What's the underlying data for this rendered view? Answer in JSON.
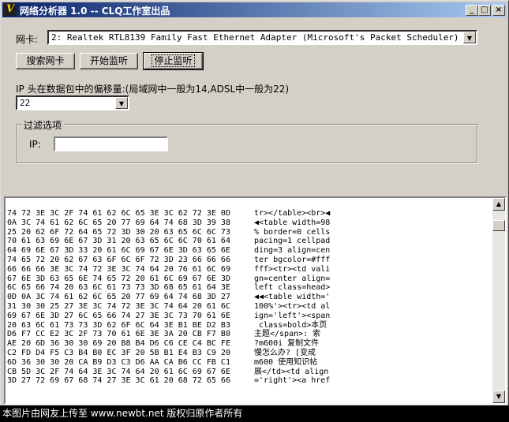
{
  "window": {
    "title": "网络分析器 1.0 -- CLQ工作室出品",
    "icon_glyph": "V",
    "minimize_glyph": "_",
    "maximize_glyph": "□",
    "close_glyph": "×"
  },
  "adapter": {
    "label": "网卡:",
    "value": "2: Realtek RTL8139 Family Fast Ethernet Adapter (Microsoft's Packet Scheduler)"
  },
  "buttons": {
    "search": "搜索网卡",
    "start": "开始监听",
    "stop": "停止监听"
  },
  "offset": {
    "label": "IP 头在数据包中的偏移量:(局域网中一般为14,ADSL中一般为22)",
    "value": "22"
  },
  "filter": {
    "group_title": "过滤选项",
    "ip_label": "IP:",
    "ip_value": ""
  },
  "dump": {
    "rows": [
      {
        "hex": "74 72 3E 3C 2F 74 61 62 6C 65 3E 3C 62 72 3E 0D",
        "ascii": "tr></table><br>◀"
      },
      {
        "hex": "0A 3C 74 61 62 6C 65 20 77 69 64 74 68 3D 39 38",
        "ascii": "◀<table width=98"
      },
      {
        "hex": "25 20 62 6F 72 64 65 72 3D 30 20 63 65 6C 6C 73",
        "ascii": "% border=0 cells"
      },
      {
        "hex": "70 61 63 69 6E 67 3D 31 20 63 65 6C 6C 70 61 64",
        "ascii": "pacing=1 cellpad"
      },
      {
        "hex": "64 69 6E 67 3D 33 20 61 6C 69 67 6E 3D 63 65 6E",
        "ascii": "ding=3 align=cen"
      },
      {
        "hex": "74 65 72 20 62 67 63 6F 6C 6F 72 3D 23 66 66 66",
        "ascii": "ter bgcolor=#fff"
      },
      {
        "hex": "66 66 66 3E 3C 74 72 3E 3C 74 64 20 76 61 6C 69",
        "ascii": "fff><tr><td vali"
      },
      {
        "hex": "67 6E 3D 63 65 6E 74 65 72 20 61 6C 69 67 6E 3D",
        "ascii": "gn=center align="
      },
      {
        "hex": "6C 65 66 74 20 63 6C 61 73 73 3D 68 65 61 64 3E",
        "ascii": "left class=head>"
      },
      {
        "hex": "0D 0A 3C 74 61 62 6C 65 20 77 69 64 74 68 3D 27",
        "ascii": "◀◀<table width='"
      },
      {
        "hex": "31 30 30 25 27 3E 3C 74 72 3E 3C 74 64 20 61 6C",
        "ascii": "100%'><tr><td al"
      },
      {
        "hex": "69 67 6E 3D 27 6C 65 66 74 27 3E 3C 73 70 61 6E",
        "ascii": "ign='left'><span"
      },
      {
        "hex": "20 63 6C 61 73 73 3D 62 6F 6C 64 3E B1 BE D2 B3",
        "ascii": " class=bold>本页"
      },
      {
        "hex": "D6 F7 CC E2 3C 2F 73 70 61 6E 3E 3A 20 CB F7 B0",
        "ascii": "主题</span>: 索"
      },
      {
        "hex": "AE 20 6D 36 30 30 69 20 B8 B4 D6 C6 CE C4 BC FE",
        "ascii": "?m600i 复制文件"
      },
      {
        "hex": "C2 FD D4 F5 C3 B4 B0 EC 3F 20 5B B1 E4 B3 C9 20",
        "ascii": "慢怎么办? [变成"
      },
      {
        "hex": "6D 36 30 30 20 CA B9 D3 C3 D6 AA CA B6 CC FB C1",
        "ascii": "m600 使用知识帖"
      },
      {
        "hex": "CB 5D 3C 2F 74 64 3E 3C 74 64 20 61 6C 69 67 6E",
        "ascii": "展</td><td align"
      },
      {
        "hex": "3D 27 72 69 67 68 74 27 3E 3C 61 20 68 72 65 66",
        "ascii": "='right'><a href"
      }
    ]
  },
  "scrollbar": {
    "up_glyph": "▲",
    "down_glyph": "▼"
  },
  "footer": {
    "text": "本图片由网友上传至 www.newbt.net 版权归原作者所有"
  },
  "colors": {
    "window_bg": "#d4d0c8",
    "titlebar_start": "#0a246a",
    "titlebar_end": "#a6caf0",
    "footer_bg": "#000000"
  }
}
